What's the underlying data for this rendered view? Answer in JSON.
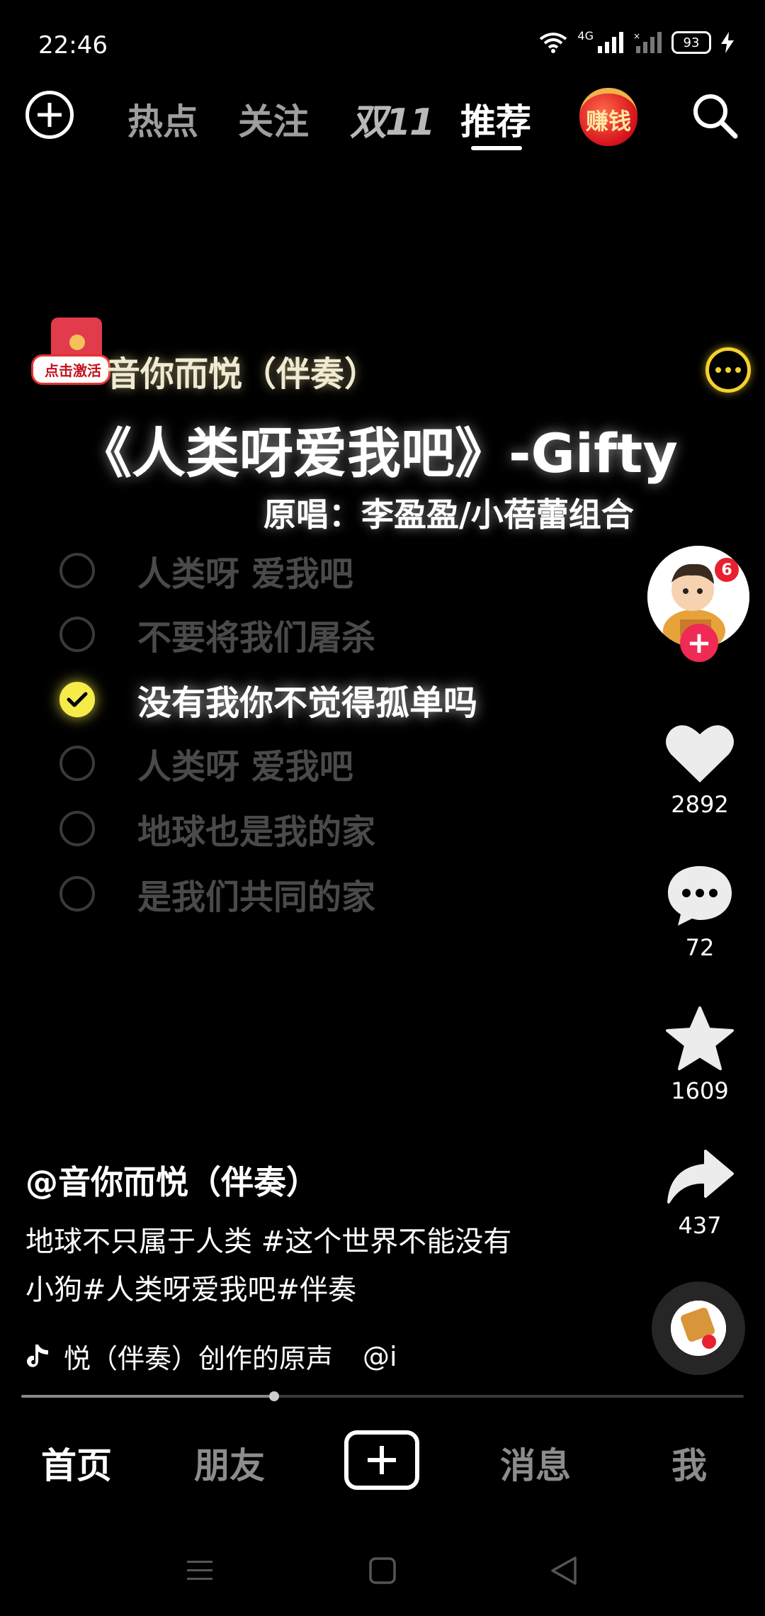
{
  "status_bar": {
    "time": "22:46",
    "battery": "93",
    "network": "4G"
  },
  "top_nav": {
    "tabs": [
      {
        "label": "热点",
        "active": false
      },
      {
        "label": "关注",
        "active": false
      },
      {
        "label": "双11",
        "active": false
      },
      {
        "label": "推荐",
        "active": true
      }
    ],
    "earn_label": "赚钱"
  },
  "redpacket": {
    "label": "点击激活"
  },
  "video": {
    "header": "音你而悦（伴奏）",
    "title": "《人类呀爱我吧》-Gifty",
    "original_singer": "原唱：李盈盈/小蓓蕾组合",
    "lyrics": [
      {
        "text": "人类呀 爱我吧",
        "checked": false
      },
      {
        "text": "不要将我们屠杀",
        "checked": false
      },
      {
        "text": "没有我你不觉得孤单吗",
        "checked": true
      },
      {
        "text": "人类呀 爱我吧",
        "checked": false
      },
      {
        "text": "地球也是我的家",
        "checked": false
      },
      {
        "text": "是我们共同的家",
        "checked": false
      }
    ]
  },
  "rail": {
    "avatar_badge": "6",
    "likes": "2892",
    "comments": "72",
    "favorites": "1609",
    "shares": "437"
  },
  "caption": {
    "author": "@音你而悦（伴奏）",
    "text_line1": "地球不只属于人类 #这个世界不能没有",
    "text_line2": "小狗#人类呀爱我吧#伴奏",
    "music": "悦（伴奏）创作的原声",
    "music_author": "@i",
    "progress": 0.35
  },
  "bottom_nav": {
    "items": [
      {
        "label": "首页",
        "active": true
      },
      {
        "label": "朋友",
        "active": false
      },
      {
        "label": "消息",
        "active": false
      },
      {
        "label": "我",
        "active": false
      }
    ]
  },
  "colors": {
    "accent_yellow": "#f5ec4a",
    "follow_red": "#ee2a55"
  }
}
